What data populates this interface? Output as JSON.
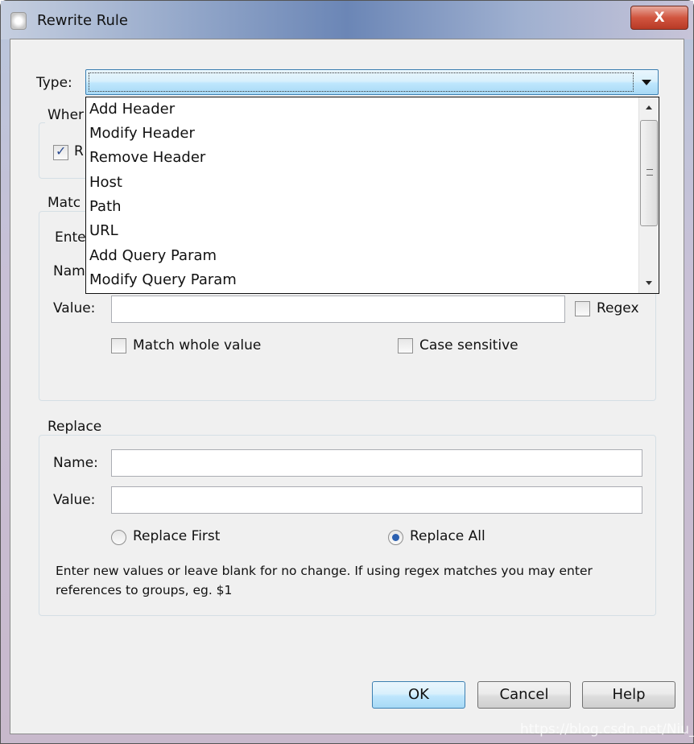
{
  "window": {
    "title": "Rewrite Rule",
    "close_label": "X"
  },
  "type": {
    "label": "Type:",
    "value": "",
    "options": [
      "Add Header",
      "Modify Header",
      "Remove Header",
      "Host",
      "Path",
      "URL",
      "Add Query Param",
      "Modify Query Param"
    ]
  },
  "when": {
    "title_fragment": "Wher",
    "checkbox_fragment": "R",
    "checked": true
  },
  "match": {
    "title_fragment": "Matc",
    "enter_fragment": "Ente",
    "name_fragment": "Nam",
    "value_label": "Value:",
    "value": "",
    "regex_label": "Regex",
    "match_whole_label": "Match whole value",
    "case_sensitive_label": "Case sensitive"
  },
  "replace": {
    "title": "Replace",
    "name_label": "Name:",
    "name_value": "",
    "value_label": "Value:",
    "value_value": "",
    "replace_first_label": "Replace First",
    "replace_all_label": "Replace All",
    "selected": "Replace All",
    "help_text_1": "Enter new values or leave blank for no change. If using regex matches you may enter",
    "help_text_2": "references to groups, eg. $1"
  },
  "buttons": {
    "ok": "OK",
    "cancel": "Cancel",
    "help": "Help"
  },
  "watermark": "https://blog.csdn.net/Niu_Eva"
}
